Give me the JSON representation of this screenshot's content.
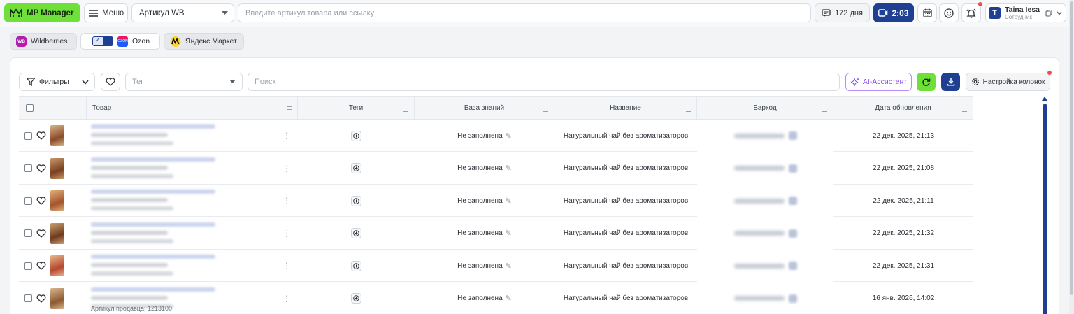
{
  "topbar": {
    "logo_label": "MP Manager",
    "menu_label": "Меню",
    "article_select": "Артикул WB",
    "search_placeholder": "Введите артикул товара или ссылку",
    "days_label": "172 дня",
    "timer_label": "2:03",
    "user": {
      "initial": "T",
      "name": "Taina Iesa",
      "role": "Сотрудник"
    }
  },
  "marketplaces": [
    {
      "label": "Wildberries",
      "logo_text": "WB"
    },
    {
      "label": "Ozon",
      "logo_text": "OZON"
    },
    {
      "label": "Яндекс Маркет"
    }
  ],
  "toolbar": {
    "filters_label": "Фильтры",
    "tag_placeholder": "Тег",
    "search_placeholder": "Поиск",
    "ai_label": "AI-Ассистент",
    "columns_label": "Настройка колонок"
  },
  "table": {
    "columns": [
      "Товар",
      "Теги",
      "База знаний",
      "Название",
      "Баркод",
      "Дата обновления"
    ],
    "rows": [
      {
        "knowledge": "Не заполнена",
        "name": "Натуральный чай без ароматизаторов",
        "date": "22 дек. 2025, 21:13"
      },
      {
        "knowledge": "Не заполнена",
        "name": "Натуральный чай без ароматизаторов",
        "date": "22 дек. 2025, 21:08"
      },
      {
        "knowledge": "Не заполнена",
        "name": "Натуральный чай без ароматизаторов",
        "date": "22 дек. 2025, 21:11"
      },
      {
        "knowledge": "Не заполнена",
        "name": "Натуральный чай без ароматизаторов",
        "date": "22 дек. 2025, 21:32"
      },
      {
        "knowledge": "Не заполнена",
        "name": "Натуральный чай без ароматизаторов",
        "date": "22 дек. 2025, 21:31"
      },
      {
        "knowledge": "Не заполнена",
        "name": "Натуральный чай без ароматизаторов",
        "date": "16 янв. 2026, 14:02"
      }
    ],
    "overflow_text": "Артикул продавца: 1213100"
  },
  "colors": {
    "accent_green": "#6fe03a",
    "accent_blue": "#1f3f93",
    "ai_purple": "#8a4de8"
  }
}
